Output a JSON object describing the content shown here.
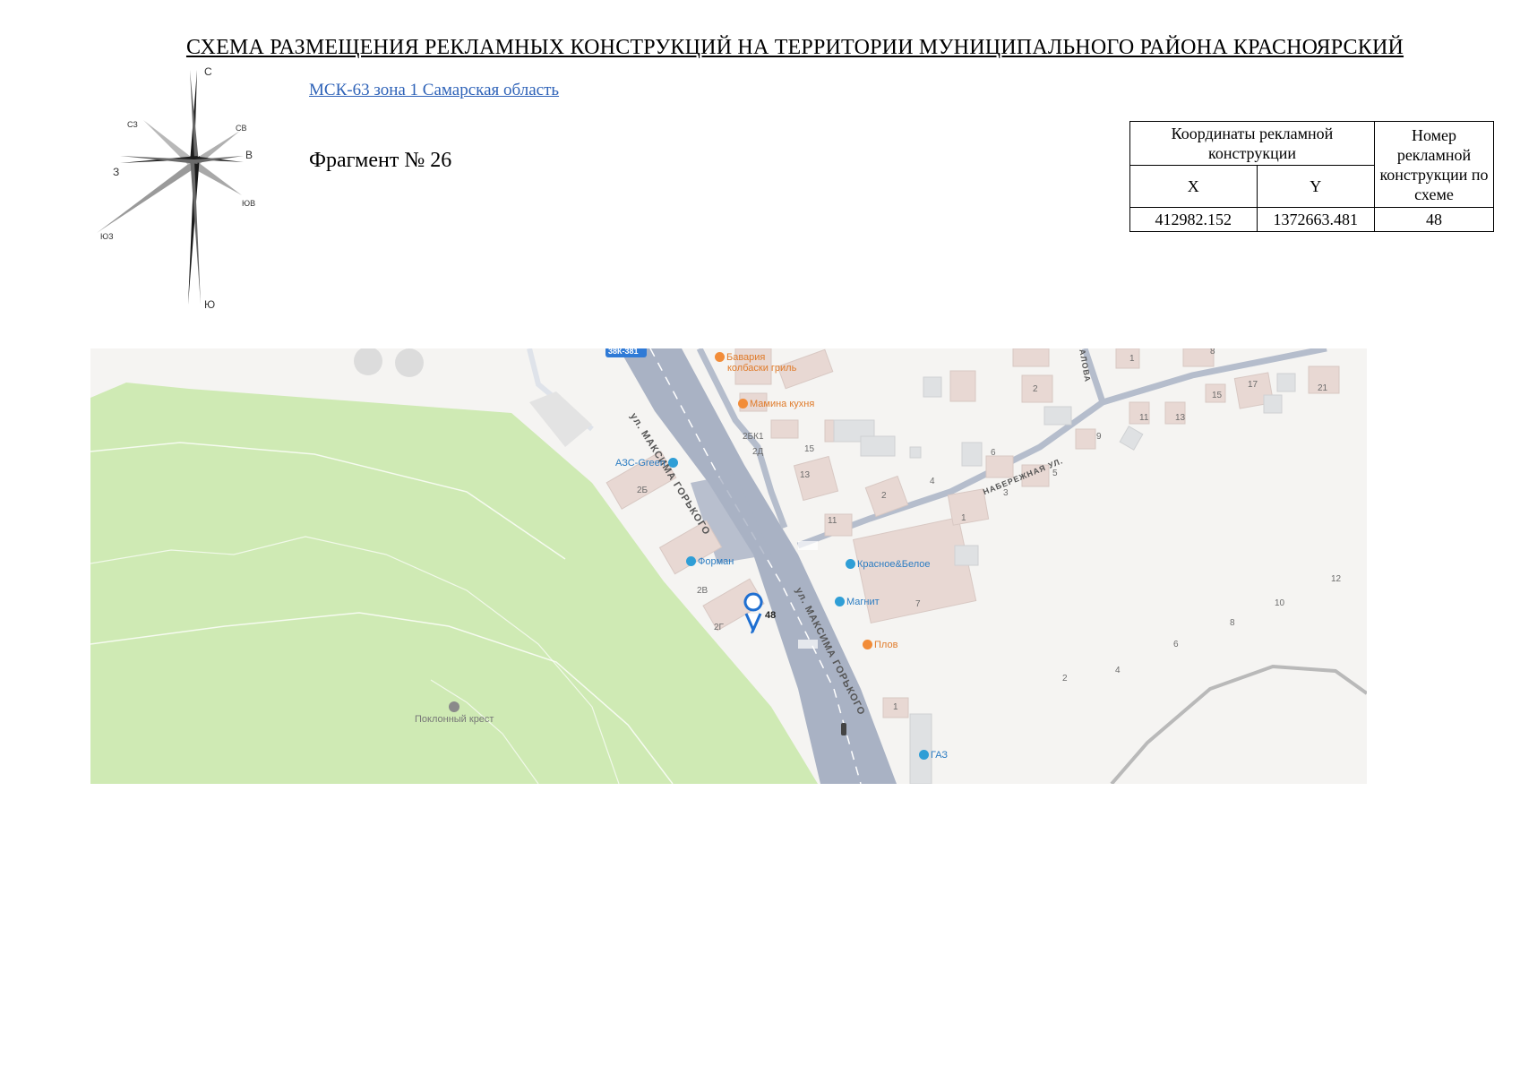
{
  "title": "СХЕМА РАЗМЕЩЕНИЯ РЕКЛАМНЫХ КОНСТРУКЦИЙ НА ТЕРРИТОРИИ МУНИЦИПАЛЬНОГО РАЙОНА КРАСНОЯРСКИЙ",
  "crs": "МСК-63 зона 1 Самарская область",
  "fragment": "Фрагмент № 26",
  "compass": {
    "n": "С",
    "ne": "СВ",
    "e": "В",
    "se": "ЮВ",
    "s": "Ю",
    "sw": "ЮЗ",
    "w": "З",
    "nw": "СЗ"
  },
  "table": {
    "coords_header": "Координаты рекламной конструкции",
    "x_header": "X",
    "y_header": "Y",
    "num_header": "Номер рекламной конструкции по схеме",
    "x": "412982.152",
    "y": "1372663.481",
    "num": "48"
  },
  "map": {
    "road_badge": "38К-381",
    "marker": "48",
    "street1": "ул. МАКСИМА ГОРЬКОГО",
    "street2": "ул. МАКСИМА ГОРЬКОГО",
    "street3": "НАБЕРЕЖНАЯ УЛ.",
    "street4": "АЛОВА",
    "poi": {
      "bavaria1": "Бавария",
      "bavaria2": "колбаски гриль",
      "mamina": "Мамина кухня",
      "azs": "АЗС-Green",
      "forman": "Форман",
      "krasnoe": "Красное&Белое",
      "magnit": "Магнит",
      "plov": "Плов",
      "gaz": "ГАЗ",
      "cross": "Поклонный крест"
    },
    "buildings": [
      "2Б",
      "2В",
      "2Г",
      "2БК1",
      "2Д",
      "15",
      "13",
      "11",
      "2",
      "4",
      "6",
      "3",
      "5",
      "1",
      "7",
      "9",
      "11",
      "13",
      "15",
      "17",
      "21",
      "2",
      "1",
      "8",
      "12",
      "10",
      "8",
      "6",
      "4",
      "2",
      "1"
    ]
  },
  "colors": {
    "park": "#cfeab4",
    "road": "#a9b2c4",
    "link": "#2f63b8"
  }
}
